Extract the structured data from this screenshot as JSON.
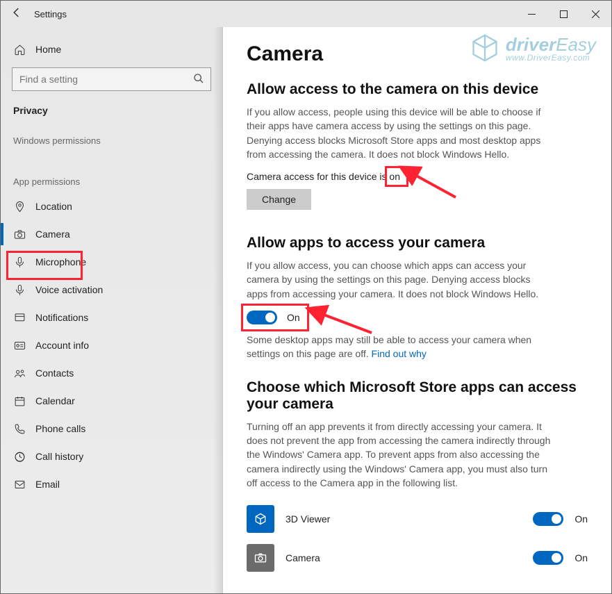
{
  "titlebar": {
    "title": "Settings"
  },
  "sidebar": {
    "home": "Home",
    "search_placeholder": "Find a setting",
    "current": "Privacy",
    "group1": "Windows permissions",
    "group2": "App permissions",
    "items": [
      {
        "label": "Location"
      },
      {
        "label": "Camera"
      },
      {
        "label": "Microphone"
      },
      {
        "label": "Voice activation"
      },
      {
        "label": "Notifications"
      },
      {
        "label": "Account info"
      },
      {
        "label": "Contacts"
      },
      {
        "label": "Calendar"
      },
      {
        "label": "Phone calls"
      },
      {
        "label": "Call history"
      },
      {
        "label": "Email"
      }
    ]
  },
  "main": {
    "h1": "Camera",
    "s1_h": "Allow access to the camera on this device",
    "s1_p": "If you allow access, people using this device will be able to choose if their apps have camera access by using the settings on this page. Denying access blocks Microsoft Store apps and most desktop apps from accessing the camera. It does not block Windows Hello.",
    "s1_status_pre": "Camera access for this device is ",
    "s1_status_val": "on",
    "s1_btn": "Change",
    "s2_h": "Allow apps to access your camera",
    "s2_p": "If you allow access, you can choose which apps can access your camera by using the settings on this page. Denying access blocks apps from accessing your camera. It does not block Windows Hello.",
    "s2_toggle": "On",
    "s2_note_pre": "Some desktop apps may still be able to access your camera when settings on this page are off. ",
    "s2_link": "Find out why",
    "s3_h": "Choose which Microsoft Store apps can access your camera",
    "s3_p": "Turning off an app prevents it from directly accessing your camera. It does not prevent the app from accessing the camera indirectly through the Windows' Camera app. To prevent apps from also accessing the camera indirectly using the Windows' Camera app, you must also turn off access to the Camera app in the following list.",
    "apps": [
      {
        "name": "3D Viewer",
        "state": "On"
      },
      {
        "name": "Camera",
        "state": "On"
      }
    ]
  },
  "watermark": {
    "line1a": "driver",
    "line1b": "Easy",
    "line2": "www.DriverEasy.com"
  }
}
